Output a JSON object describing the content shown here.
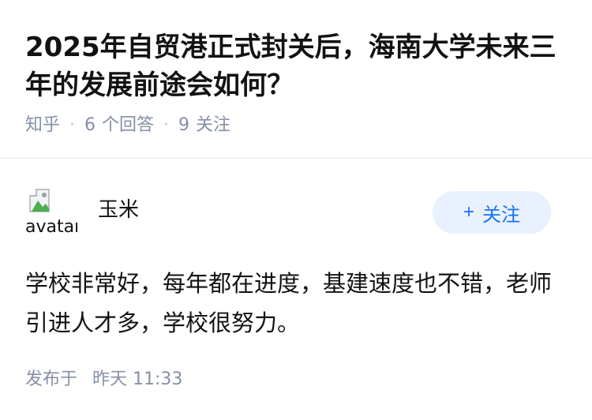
{
  "question": {
    "title": "2025年自贸港正式封关后，海南大学未来三年的发展前途会如何？",
    "source": "知乎",
    "answer_count": "6",
    "answer_count_label": "个回答",
    "follower_count": "9",
    "follower_label": "关注"
  },
  "answer": {
    "author": {
      "avatar_alt": "avatar",
      "name": "玉米"
    },
    "follow_button": {
      "icon": "plus-icon",
      "label": "关注"
    },
    "content": "学校非常好，每年都在进度，基建速度也不错，老师引进人才多，学校很努力。",
    "published_label": "发布于",
    "published_time": "昨天 11:33"
  },
  "colors": {
    "text_primary": "#121212",
    "text_secondary": "#8590a6",
    "accent": "#1772f6",
    "accent_bg": "#e8f1fd"
  }
}
